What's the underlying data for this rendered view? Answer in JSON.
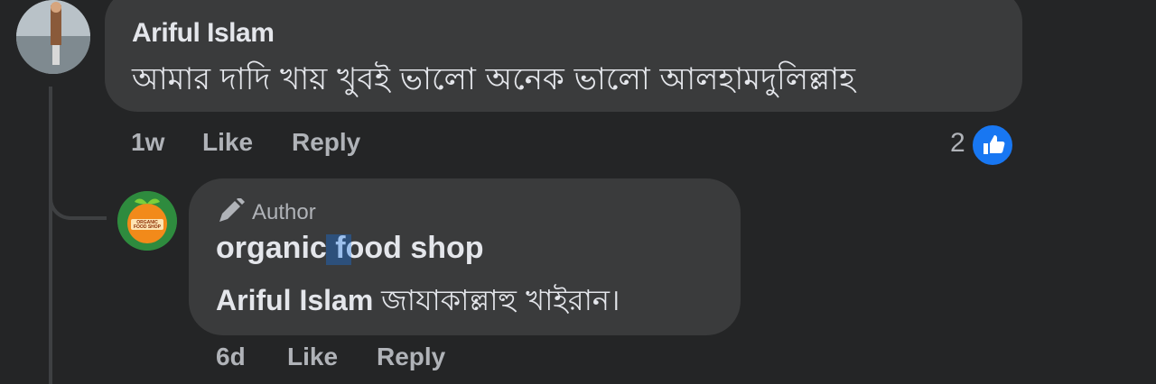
{
  "comment": {
    "author": "Ariful Islam",
    "text": "আমার দাদি খায় খুবই ভালো অনেক ভালো আলহামদুলিল্লাহ",
    "time": "1w",
    "like_label": "Like",
    "reply_label": "Reply",
    "reaction_count": "2",
    "reaction_icon": "thumbs-up-icon"
  },
  "reply": {
    "badge": "Author",
    "badge_icon": "pencil-icon",
    "author": "organic food shop",
    "mention": "Ariful Islam",
    "text": "জাযাকাল্লাহু খাইরান।",
    "time": "6d",
    "like_label": "Like",
    "reply_label": "Reply",
    "avatar_text": "ORGANIC FOOD SHOP"
  },
  "colors": {
    "background": "#242526",
    "bubble": "#3a3b3c",
    "meta_text": "#b0b3b8",
    "like_blue": "#1877f2"
  }
}
